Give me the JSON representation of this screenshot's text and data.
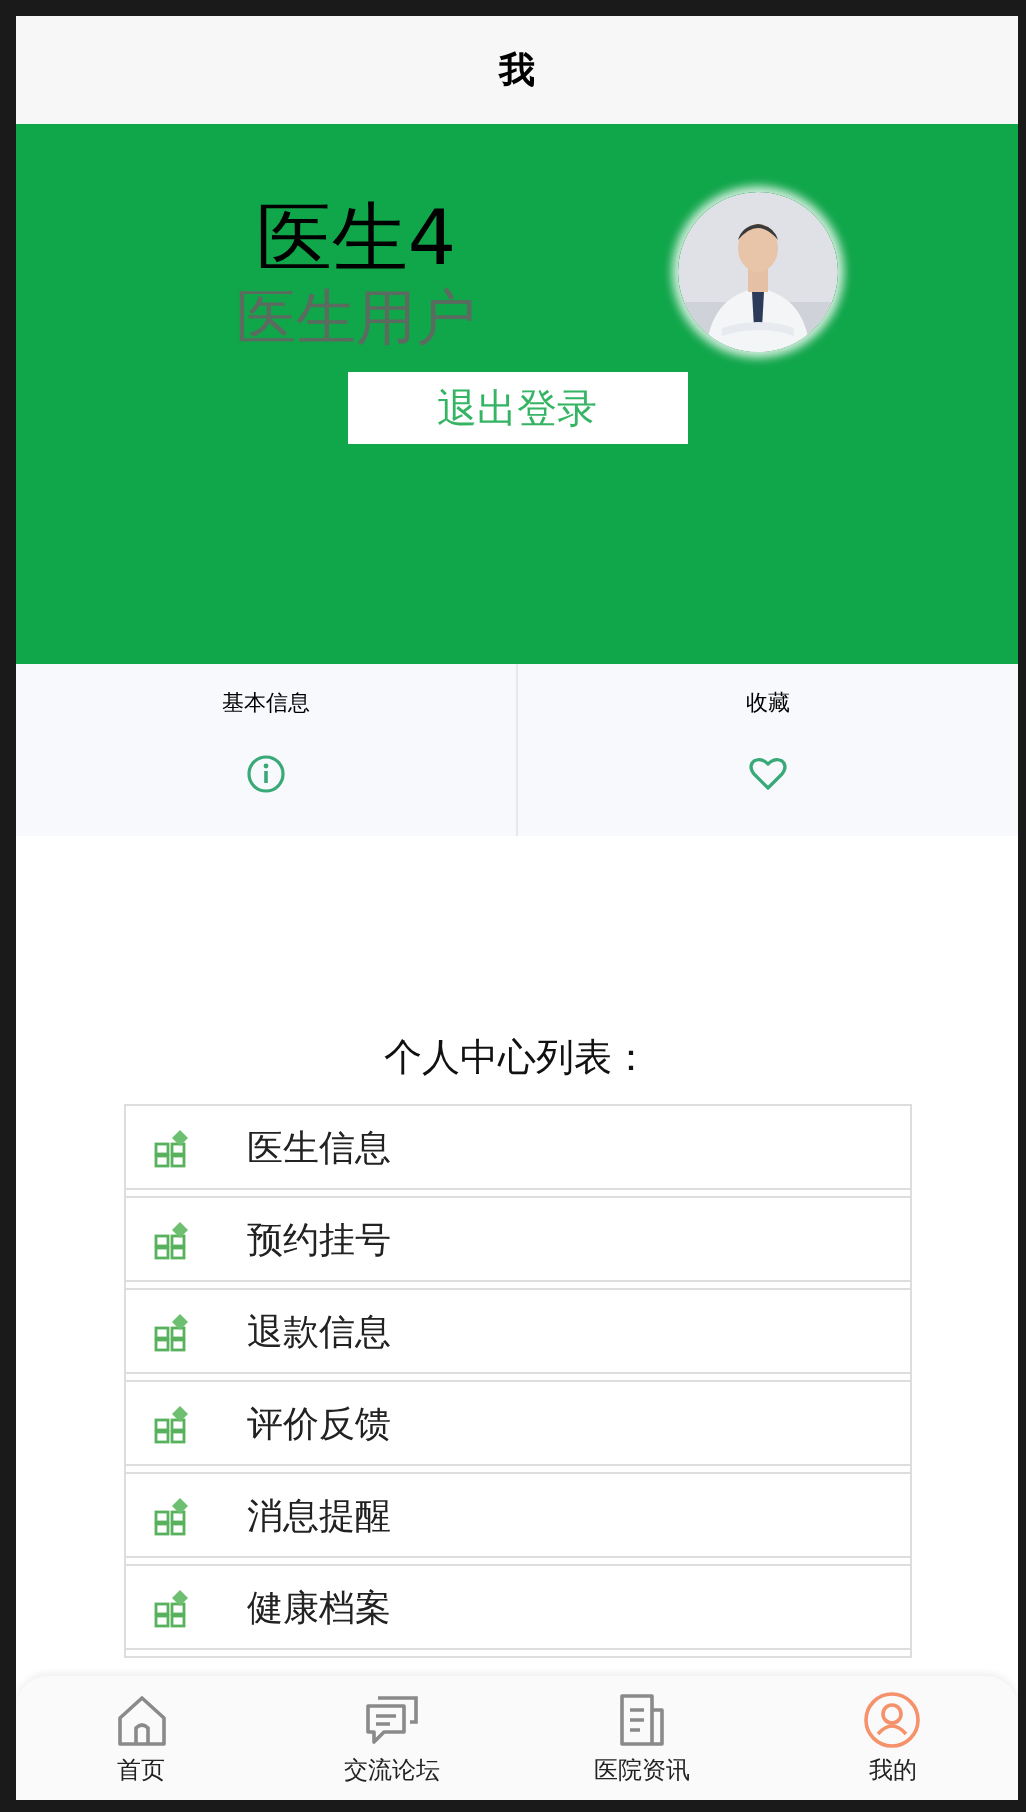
{
  "header": {
    "title": "我"
  },
  "profile": {
    "name": "医生4",
    "role": "医生用户",
    "logout_button": "退出登录"
  },
  "shortcuts": [
    {
      "label": "基本信息"
    },
    {
      "label": "收藏"
    }
  ],
  "list": {
    "title": "个人中心列表：",
    "items": [
      "医生信息",
      "预约挂号",
      "退款信息",
      "评价反馈",
      "消息提醒",
      "健康档案"
    ]
  },
  "tab_bar": [
    {
      "label": "首页",
      "selected": false
    },
    {
      "label": "交流论坛",
      "selected": false
    },
    {
      "label": "医院资讯",
      "selected": false
    },
    {
      "label": "我的",
      "selected": true
    }
  ]
}
